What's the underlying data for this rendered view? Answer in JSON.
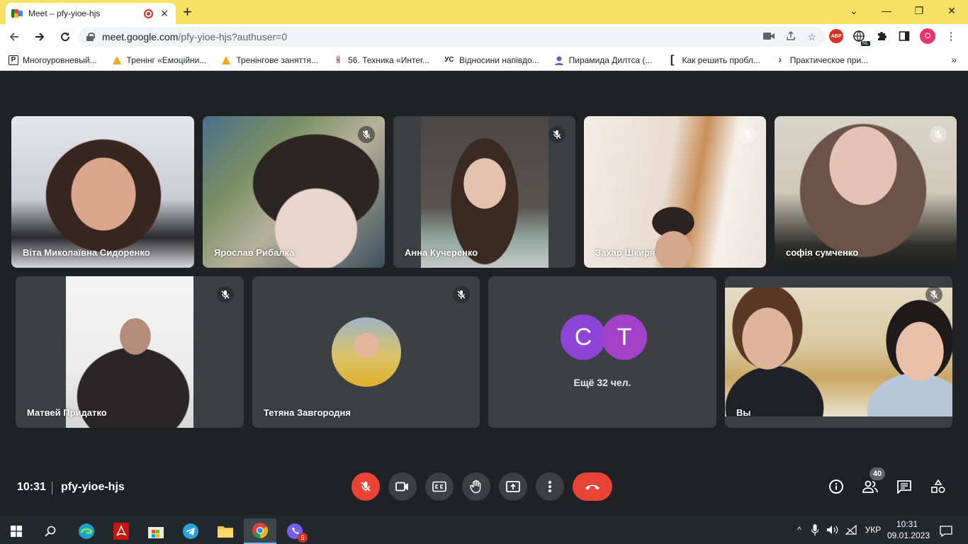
{
  "browser": {
    "tab_title": "Meet – pfy-yioe-hjs",
    "url_host": "meet.google.com",
    "url_path": "/pfy-yioe-hjs?authuser=0",
    "profile_letter": "O",
    "abp_label": "ABP",
    "ext_badge": "NL",
    "bookmarks": [
      {
        "icon": "p-icon",
        "label": "Многоуровневый..."
      },
      {
        "icon": "warning-icon",
        "label": "Тренінг «Емоційни..."
      },
      {
        "icon": "warning-icon",
        "label": "Тренінгове заняття..."
      },
      {
        "icon": "hh-icon",
        "label": "56. Техника «Интег..."
      },
      {
        "icon": "yc-icon",
        "label": "Відносини напівдо..."
      },
      {
        "icon": "person-icon",
        "label": "Пирамида Дилтса (..."
      },
      {
        "icon": "bracket-icon",
        "label": "Как решить пробл..."
      },
      {
        "icon": "arrow-icon",
        "label": "Практическое при..."
      }
    ]
  },
  "meet": {
    "participants": [
      {
        "name": "Віта Миколаївна Сидоренко"
      },
      {
        "name": "Ярослав Рибалка"
      },
      {
        "name": "Анна Кучеренко"
      },
      {
        "name": "Захар Шкиря"
      },
      {
        "name": "софія сумченко"
      },
      {
        "name": "Матвей Придатко"
      },
      {
        "name": "Тетяна Завгородня"
      },
      {
        "name": "Вы"
      }
    ],
    "more": {
      "letters": [
        "С",
        "Т"
      ],
      "colors": [
        "#8e44d6",
        "#a142c9"
      ],
      "label": "Ещё 32 чел."
    },
    "time": "10:31",
    "meeting_code": "pfy-yioe-hjs",
    "participant_count": "40",
    "end_color": "#ea4335"
  },
  "taskbar": {
    "lang": "УКР",
    "time": "10:31",
    "date": "09.01.2023",
    "viber_badge": "5"
  }
}
